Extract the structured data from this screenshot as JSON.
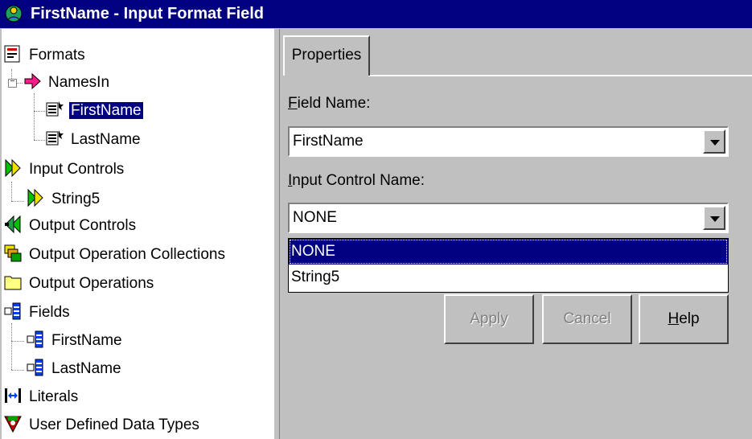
{
  "window": {
    "title": "FirstName - Input Format Field",
    "title_icon": "app-icon"
  },
  "tree": {
    "formats": {
      "label": "Formats",
      "icon": "formats-icon"
    },
    "namesin": {
      "label": "NamesIn",
      "icon": "pink-arrow-icon"
    },
    "firstname": {
      "label": "FirstName",
      "icon": "format-field-icon"
    },
    "lastname": {
      "label": "LastName",
      "icon": "format-field-icon"
    },
    "input_controls": {
      "label": "Input Controls",
      "icon": "input-controls-icon"
    },
    "string5": {
      "label": "String5",
      "icon": "input-controls-icon"
    },
    "output_controls": {
      "label": "Output Controls",
      "icon": "output-controls-icon"
    },
    "output_op_collections": {
      "label": "Output Operation Collections",
      "icon": "output-op-collections-icon"
    },
    "output_operations": {
      "label": "Output Operations",
      "icon": "folder-icon"
    },
    "fields": {
      "label": "Fields",
      "icon": "fields-icon"
    },
    "fields_firstname": {
      "label": "FirstName",
      "icon": "fields-icon"
    },
    "fields_lastname": {
      "label": "LastName",
      "icon": "fields-icon"
    },
    "literals": {
      "label": "Literals",
      "icon": "literals-icon"
    },
    "udt": {
      "label": "User Defined Data Types",
      "icon": "udt-icon"
    }
  },
  "properties": {
    "tab_label": "Properties",
    "field_name_label_first": "F",
    "field_name_label_rest": "ield Name:",
    "field_name_value": "FirstName",
    "input_control_label_first": "I",
    "input_control_label_rest": "nput Control Name:",
    "input_control_value": "NONE",
    "apply_label": "Apply",
    "cancel_label": "Cancel",
    "help_label_first": "H",
    "help_label_rest": "elp"
  },
  "dropdown": {
    "options": [
      "NONE",
      "String5"
    ],
    "selected": "NONE"
  },
  "colors": {
    "title_bar": "#000080",
    "window_face": "#c0c0c0",
    "selection": "#000080"
  }
}
